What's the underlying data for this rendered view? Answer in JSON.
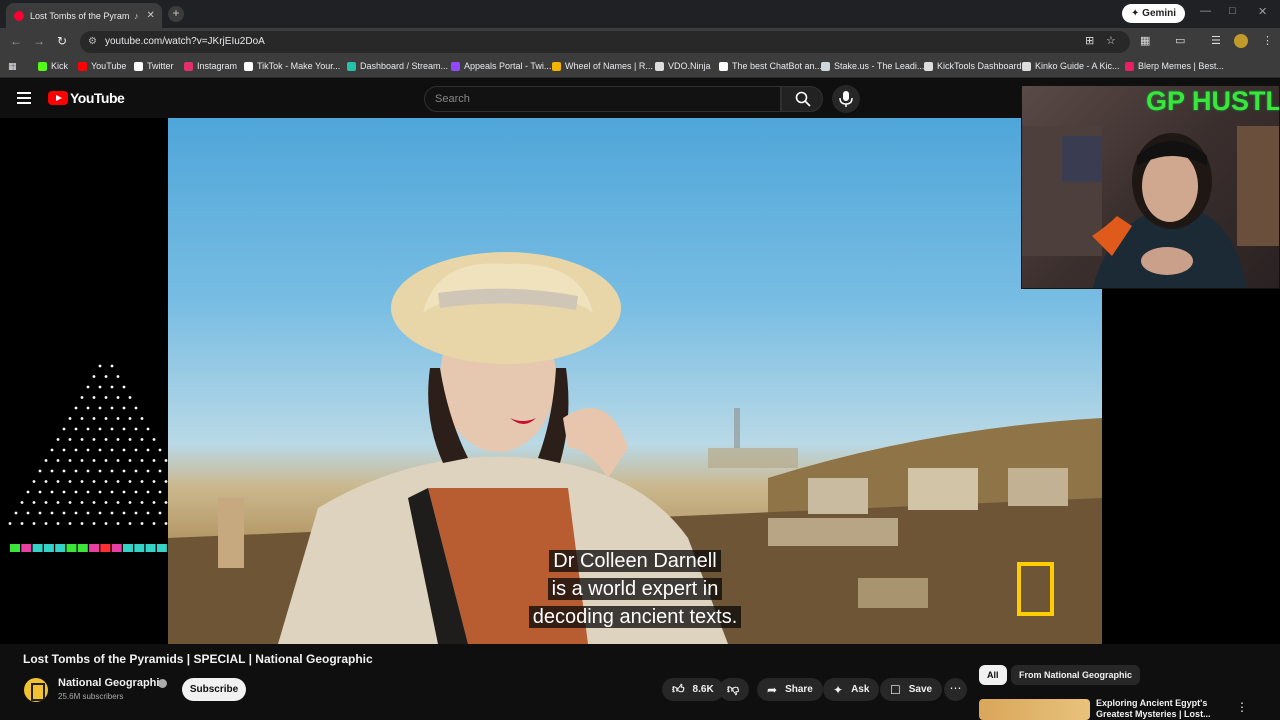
{
  "browser": {
    "tab_title": "Lost Tombs of the Pyramids",
    "tab_audio_icon": "speaker-icon",
    "new_tab_label": "+",
    "gemini_label": "Gemini",
    "url": "youtube.com/watch?v=JKrjEIu2DoA",
    "bookmarks": [
      {
        "label": "Kick",
        "color": "#53fc18"
      },
      {
        "label": "YouTube",
        "color": "#ff0000"
      },
      {
        "label": "Twitter",
        "color": "#ffffff"
      },
      {
        "label": "Instagram",
        "color": "#e1306c"
      },
      {
        "label": "TikTok - Make Your...",
        "color": "#ffffff"
      },
      {
        "label": "Dashboard / Stream...",
        "color": "#22c3a6"
      },
      {
        "label": "Appeals Portal - Twi...",
        "color": "#9146ff"
      },
      {
        "label": "Wheel of Names | R...",
        "color": "#f4b400"
      },
      {
        "label": "VDO.Ninja",
        "color": "#dddddd"
      },
      {
        "label": "The best ChatBot an...",
        "color": "#ffffff"
      },
      {
        "label": "Stake.us - The Leadi...",
        "color": "#cfd8dc"
      },
      {
        "label": "KickTools Dashboard",
        "color": "#dddddd"
      },
      {
        "label": "Kinko Guide - A Kic...",
        "color": "#dddddd"
      },
      {
        "label": "Blerp Memes | Best...",
        "color": "#e91e63"
      }
    ]
  },
  "youtube": {
    "logo_text": "YouTube",
    "search_placeholder": "Search"
  },
  "video": {
    "caption_lines": [
      "Dr Colleen Darnell",
      "is a world expert in",
      "decoding ancient texts."
    ],
    "title": "Lost Tombs of the Pyramids | SPECIAL | National Geographic"
  },
  "overlay": {
    "webcam_title": "GP HUSTLA"
  },
  "channel": {
    "name": "National Geographic",
    "subscribers": "25.6M subscribers",
    "subscribe_label": "Subscribe"
  },
  "actions": {
    "likes": "8.6K",
    "share": "Share",
    "ask": "Ask",
    "save": "Save",
    "more": "⋯"
  },
  "sidebar": {
    "chips": [
      "All",
      "From National Geographic"
    ],
    "rec_title": "Exploring Ancient Egypt's Greatest Mysteries | Lost..."
  },
  "colors": {
    "accent": "#ff0000",
    "background": "#0f0f0f",
    "natgeo_yellow": "#ffce00",
    "overlay_green": "#39e639"
  }
}
